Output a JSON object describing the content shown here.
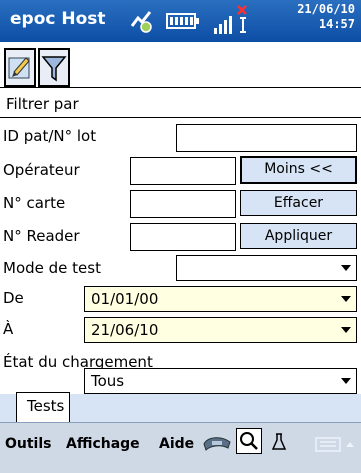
{
  "title_bar": {
    "app_title": "epoc Host",
    "date": "21/06/10",
    "time": "14:57",
    "icons": [
      "sync-icon",
      "battery-icon",
      "signal-icon"
    ]
  },
  "tabs": [
    {
      "icon": "edit-icon"
    },
    {
      "icon": "filter-icon"
    }
  ],
  "filter": {
    "header": "Filtrer par",
    "id_label": "ID pat/N° lot",
    "id_value": "",
    "operator_label": "Opérateur",
    "operator_value": "",
    "card_label": "N° carte",
    "card_value": "",
    "reader_label": "N° Reader",
    "reader_value": "",
    "less_button": "Moins <<",
    "clear_button": "Effacer",
    "apply_button": "Appliquer",
    "test_mode_label": "Mode de test",
    "test_mode_value": "",
    "from_label": "De",
    "from_value": "01/01/00",
    "to_label": "À",
    "to_value": "21/06/10",
    "upload_state_label": "État du chargement",
    "upload_state_value": "Tous"
  },
  "bottom_tab": {
    "label": "Tests"
  },
  "menubar": {
    "tools": "Outils",
    "view": "Affichage",
    "help": "Aide",
    "icons": [
      "reader-icon",
      "search-icon",
      "flask-icon",
      "keyboard-icon"
    ]
  },
  "colors": {
    "titlebar": "#1a5fb4",
    "button": "#d6e4f5",
    "date_field": "#ffffe1"
  }
}
